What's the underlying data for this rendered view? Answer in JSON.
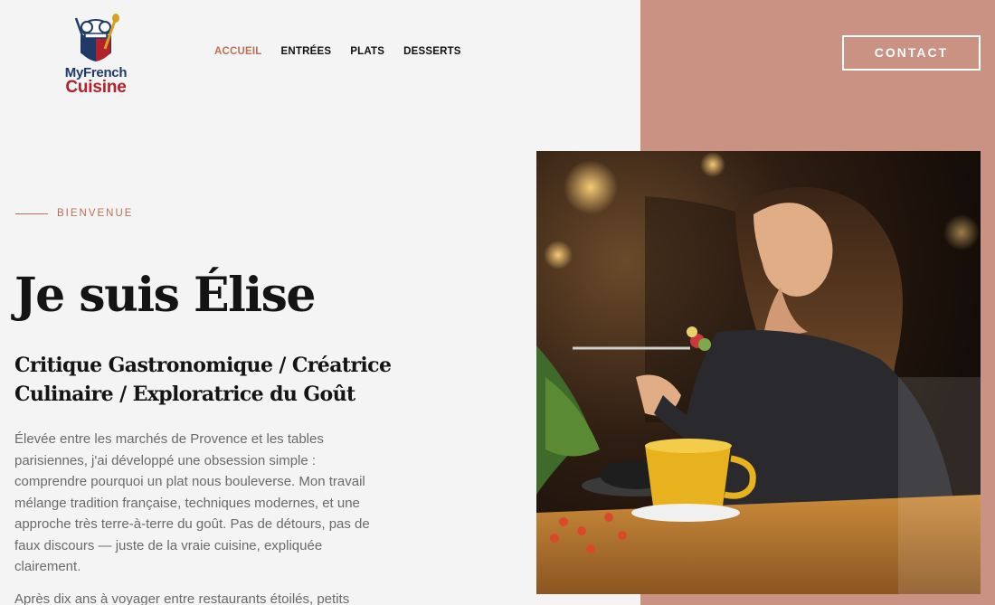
{
  "brand": {
    "line1": "MyFrench",
    "line2": "Cuisine",
    "icon": "chef-hat-icon"
  },
  "nav": {
    "items": [
      {
        "label": "ACCUEIL",
        "active": true
      },
      {
        "label": "ENTRÉES",
        "active": false
      },
      {
        "label": "PLATS",
        "active": false
      },
      {
        "label": "DESSERTS",
        "active": false
      }
    ]
  },
  "header": {
    "contact_label": "CONTACT"
  },
  "hero": {
    "eyebrow": "BIENVENUE",
    "title": "Je suis Élise",
    "subtitle": "Critique Gastronomique / Créatrice Culinaire / Exploratrice du Goût",
    "paragraph1": "Élevée entre les marchés de Provence et les tables parisiennes, j'ai développé une obsession simple : comprendre pourquoi un plat nous bouleverse. Mon travail mélange tradition française, techniques modernes, et une approche très terre-à-terre du goût. Pas de détours, pas de faux discours — juste de la vraie cuisine, expliquée clairement.",
    "paragraph2": "Après dix ans à voyager entre restaurants étoilés, petits"
  },
  "colors": {
    "accent": "#c06f55",
    "panel": "#c99282",
    "background": "#f4f4f4",
    "text": "#141414"
  }
}
